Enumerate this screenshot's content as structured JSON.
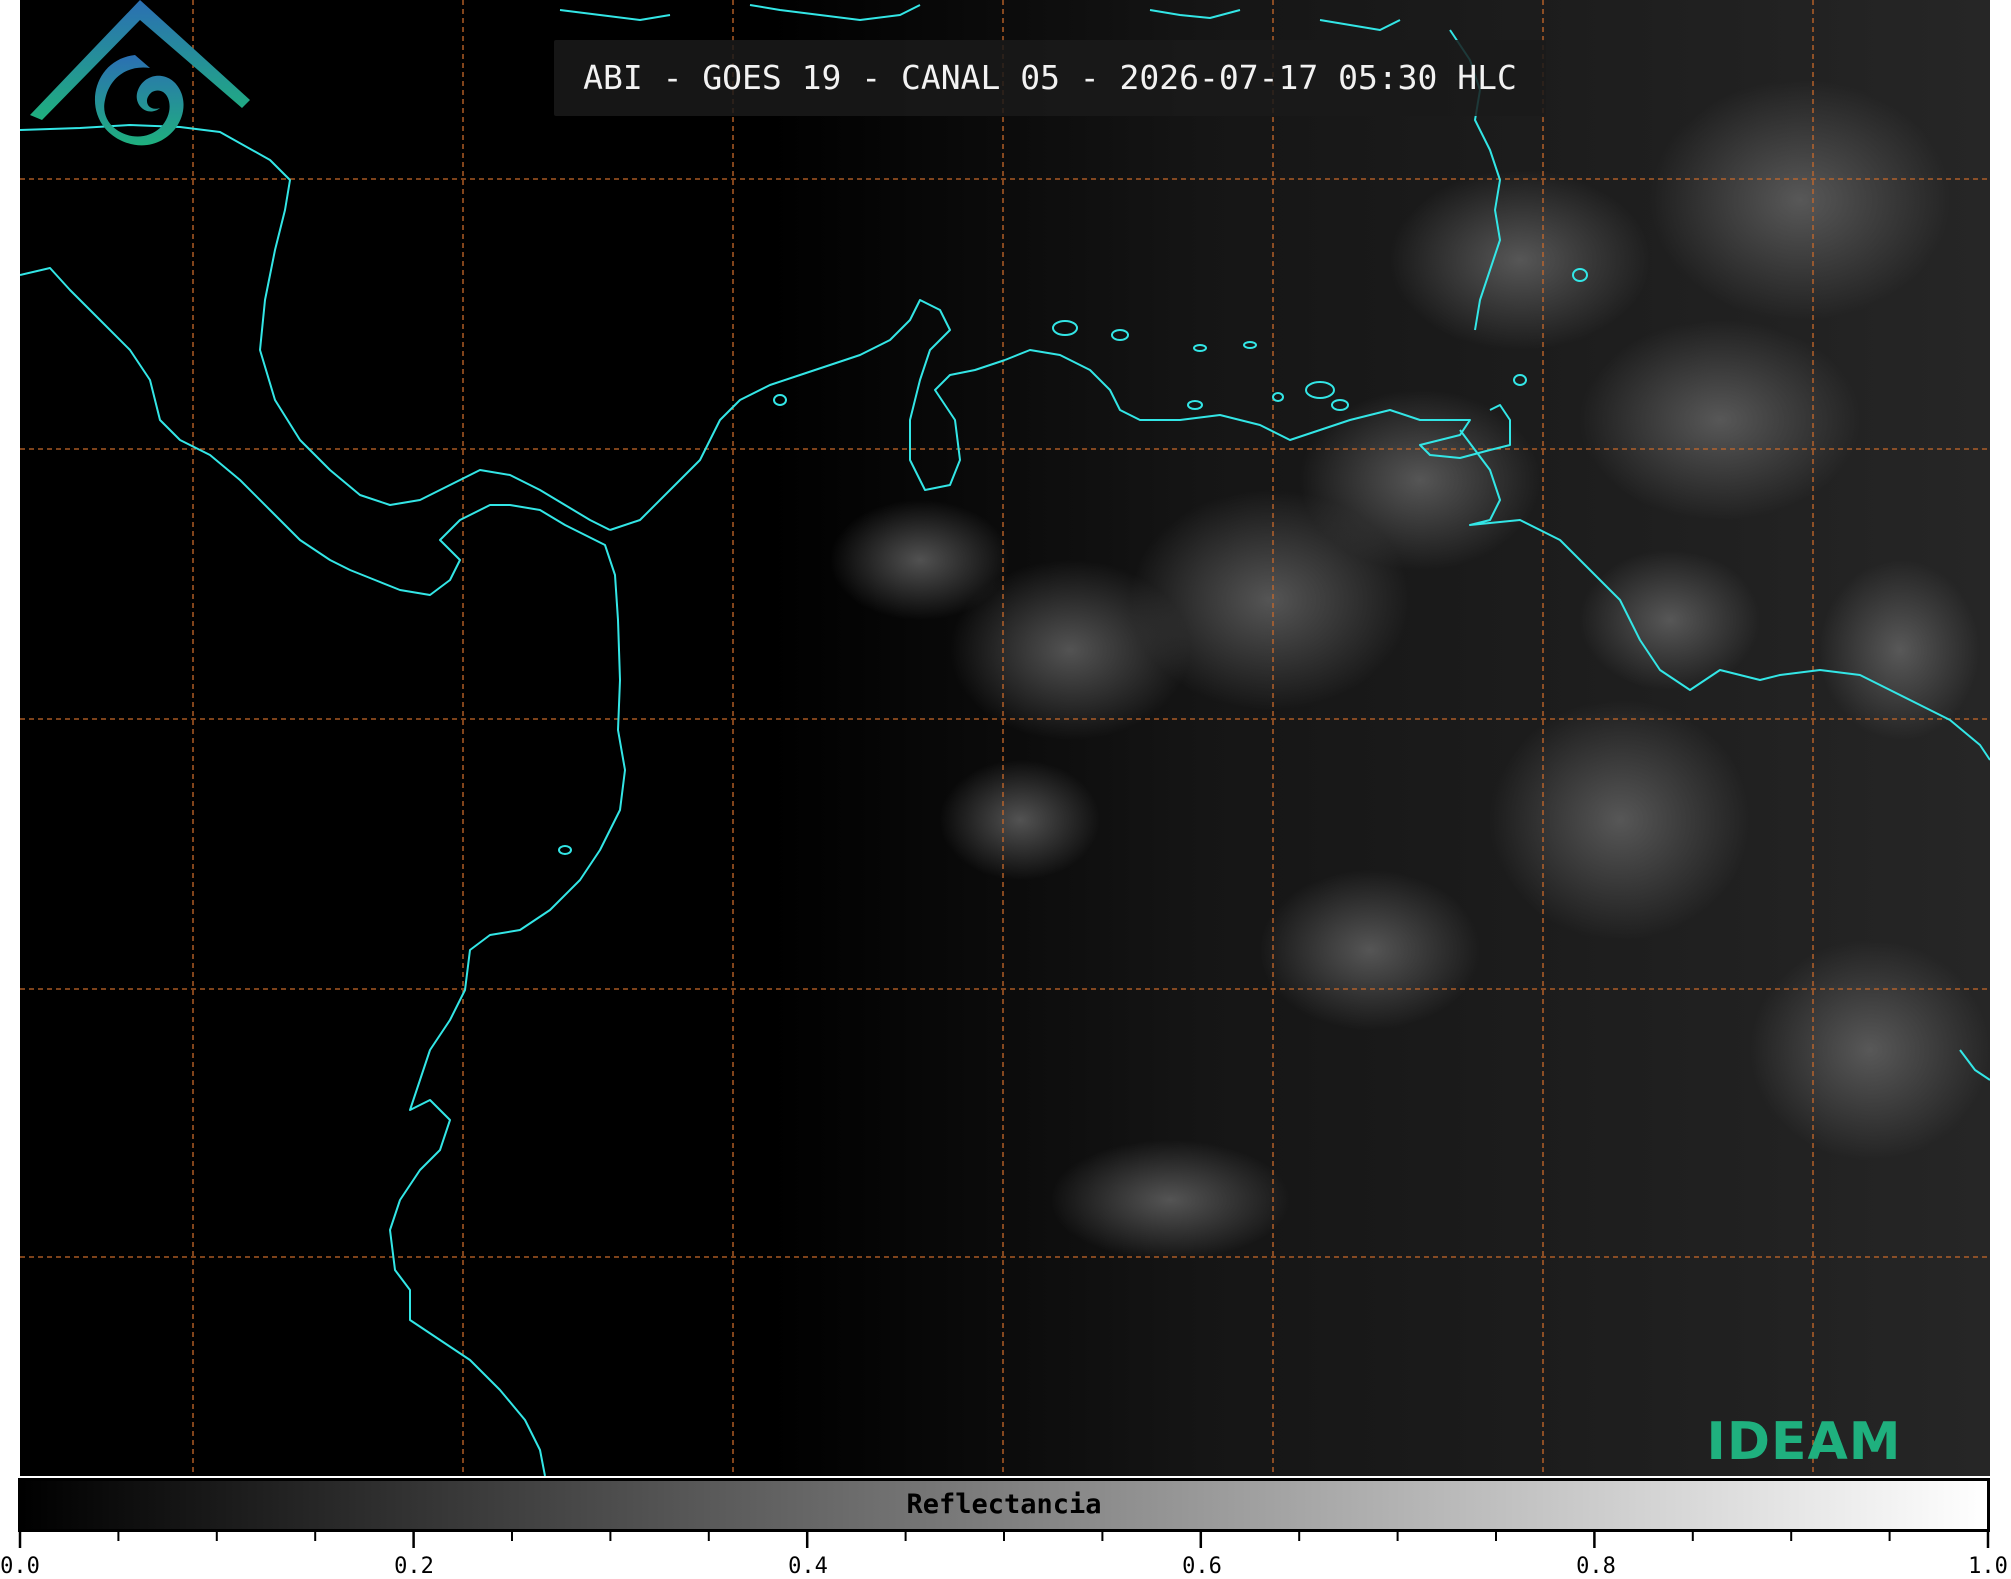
{
  "title": "ABI - GOES 19 - CANAL 05 - 2026-07-17 05:30 HLC",
  "colorbar": {
    "label": "Reflectancia",
    "ticks": [
      "0.0",
      "0.2",
      "0.4",
      "0.6",
      "0.8",
      "1.0"
    ],
    "range": [
      0.0,
      1.0
    ],
    "colormap": "grayscale"
  },
  "logo": {
    "text": "IDEAM"
  },
  "colors": {
    "coastline": "#33e6e6",
    "gridline": "#c8692a",
    "background": "#000000",
    "logo_top": "#2b6fb3",
    "logo_bottom": "#1fb07e"
  },
  "map": {
    "graticule": "dashed",
    "coastlines": true
  }
}
